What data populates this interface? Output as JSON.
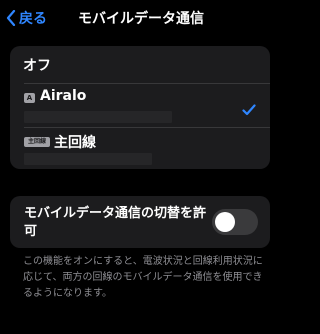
{
  "nav": {
    "back_label": "戻る",
    "title": "モバイルデータ通信"
  },
  "lines": {
    "off_label": "オフ",
    "items": [
      {
        "badge": "A",
        "name": "Airalo",
        "selected": true
      },
      {
        "badge": "主回線",
        "name": "主回線",
        "selected": false
      }
    ]
  },
  "switching": {
    "label": "モバイルデータ通信の切替を許可",
    "enabled": false
  },
  "footer": {
    "text": "この機能をオンにすると、電波状況と回線利用状況に応じて、両方の回線のモバイルデータ通信を使用できるようになります。"
  },
  "colors": {
    "accent": "#2f86ff",
    "background": "#000000",
    "cell": "#1c1c1e",
    "secondary_text": "#8e8e93"
  }
}
